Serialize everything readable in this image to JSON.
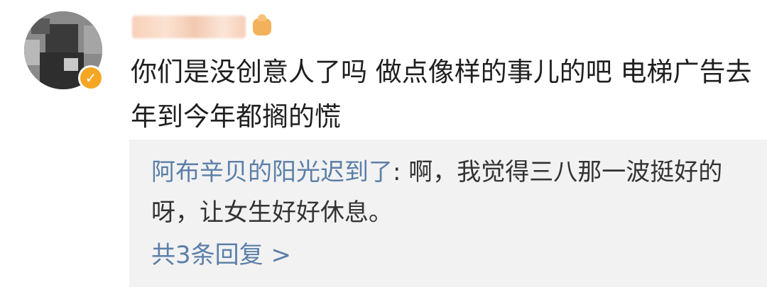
{
  "comment": {
    "author_avatar_icon": "pixelated-avatar",
    "verified_icon": "verified-check-icon",
    "level_icon": "trophy-badge-icon",
    "text": "你们是没创意人了吗 做点像样的事儿的吧 电梯广告去年到今年都搁的慌"
  },
  "reply": {
    "author": "阿布辛贝的阳光迟到了",
    "separator": ":",
    "text": " 啊，我觉得三八那一波挺好的呀，让女生好好休息。",
    "more_label": "共3条回复 >"
  },
  "colors": {
    "link_blue": "#5b7fa8",
    "reply_bg": "#f2f2f2",
    "verified_orange": "#f5a623"
  }
}
